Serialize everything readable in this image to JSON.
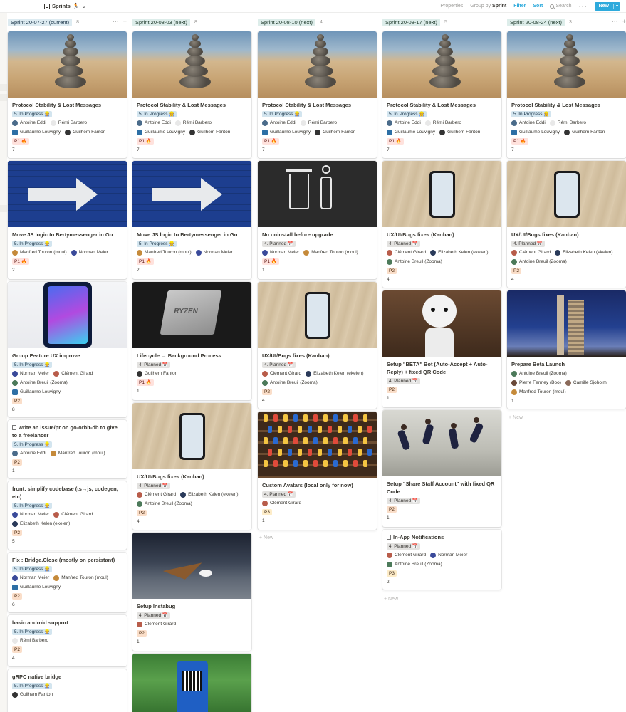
{
  "topbar": {
    "title": "Sprints",
    "properties": "Properties",
    "group_by": "Group by",
    "group_by_value": "Sprint",
    "filter": "Filter",
    "sort": "Sort",
    "search": "Search",
    "more": "···",
    "new": "New"
  },
  "add_new": "+ New",
  "columns": [
    {
      "name": "Sprint 20-07-27 (current)",
      "count": "8",
      "cards": [
        {
          "title": "Protocol Stability & Lost Messages",
          "status": "5. In Progress 👷",
          "people": [
            "Antoine Eddi",
            "Rémi Barbero",
            "Guillaume Louvigny",
            "Guilhem Fanton"
          ],
          "priority": "P1 🔥",
          "points": "7"
        },
        {
          "title": "Move JS logic to Bertymessenger in Go",
          "status": "5. In Progress 👷",
          "people": [
            "Manfred Touron (moul)",
            "Norman Meier"
          ],
          "priority": "P1 🔥",
          "points": "2"
        },
        {
          "title": "Group Feature UX improve",
          "status": "5. In Progress 👷",
          "people": [
            "Norman Meier",
            "Clément Girard",
            "Antoine Breuil (Zooma)",
            "Guillaume Louvigny"
          ],
          "priority": "P2",
          "points": "8"
        },
        {
          "title": "write an issue/pr on go-orbit-db to give to a freelancer",
          "status": "5. In Progress 👷",
          "people": [
            "Antoine Eddi",
            "Manfred Touron (moul)"
          ],
          "priority": "P2",
          "points": "1"
        },
        {
          "title": "front: simplify codebase (ts→js, codegen, etc)",
          "status": "5. In Progress 👷",
          "people": [
            "Norman Meier",
            "Clément Girard",
            "Elizabeth Kelen (ekelen)"
          ],
          "priority": "P2",
          "points": "5"
        },
        {
          "title": "Fix : Bridge.Close (mostly on persistant)",
          "status": "5. In Progress 👷",
          "people": [
            "Norman Meier",
            "Manfred Touron (moul)",
            "Guillaume Louvigny"
          ],
          "priority": "P2",
          "points": "6"
        },
        {
          "title": "basic android support",
          "status": "5. In Progress 👷",
          "people": [
            "Rémi Barbero"
          ],
          "priority": "P2",
          "points": "4"
        },
        {
          "title": "gRPC native bridge",
          "status": "5. In Progress 👷",
          "people": [
            "Guilhem Fanton"
          ]
        }
      ]
    },
    {
      "name": "Sprint 20-08-03 (next)",
      "count": "8",
      "cards": [
        {
          "title": "Protocol Stability & Lost Messages",
          "status": "5. In Progress 👷",
          "people": [
            "Antoine Eddi",
            "Rémi Barbero",
            "Guillaume Louvigny",
            "Guilhem Fanton"
          ],
          "priority": "P1 🔥",
          "points": "7"
        },
        {
          "title": "Move JS logic to Bertymessenger in Go",
          "status": "5. In Progress 👷",
          "people": [
            "Manfred Touron (moul)",
            "Norman Meier"
          ],
          "priority": "P1 🔥",
          "points": "2"
        },
        {
          "title": "Lifecycle → Background Process",
          "status": "4. Planned 📅",
          "people": [
            "Guilhem Fanton"
          ],
          "priority": "P1 🔥",
          "points": "1"
        },
        {
          "title": "UX/UI/Bugs fixes (Kanban)",
          "status": "4. Planned 📅",
          "people": [
            "Clément Girard",
            "Elizabeth Kelen (ekelen)",
            "Antoine Breuil (Zooma)"
          ],
          "priority": "P2",
          "points": "4"
        },
        {
          "title": "Setup Instabug",
          "status": "4. Planned 📅",
          "people": [
            "Clément Girard"
          ],
          "priority": "P2",
          "points": "1"
        }
      ]
    },
    {
      "name": "Sprint 20-08-10 (next)",
      "count": "4",
      "cards": [
        {
          "title": "Protocol Stability & Lost Messages",
          "status": "5. In Progress 👷",
          "people": [
            "Antoine Eddi",
            "Rémi Barbero",
            "Guillaume Louvigny",
            "Guilhem Fanton"
          ],
          "priority": "P1 🔥",
          "points": "7"
        },
        {
          "title": "No uninstall before upgrade",
          "status": "4. Planned 📅",
          "people": [
            "Norman Meier",
            "Manfred Touron (moul)"
          ],
          "priority": "P1 🔥",
          "points": "1"
        },
        {
          "title": "UX/UI/Bugs fixes (Kanban)",
          "status": "4. Planned 📅",
          "people": [
            "Clément Girard",
            "Elizabeth Kelen (ekelen)",
            "Antoine Breuil (Zooma)"
          ],
          "priority": "P2",
          "points": "4"
        },
        {
          "title": "Custom Avatars (local only for now)",
          "status": "4. Planned 📅",
          "people": [
            "Clément Girard"
          ],
          "priority": "P3",
          "points": "1"
        }
      ]
    },
    {
      "name": "Sprint 20-08-17 (next)",
      "count": "5",
      "cards": [
        {
          "title": "Protocol Stability & Lost Messages",
          "status": "5. In Progress 👷",
          "people": [
            "Antoine Eddi",
            "Rémi Barbero",
            "Guillaume Louvigny",
            "Guilhem Fanton"
          ],
          "priority": "P1 🔥",
          "points": "7"
        },
        {
          "title": "UX/UI/Bugs fixes (Kanban)",
          "status": "4. Planned 📅",
          "people": [
            "Clément Girard",
            "Elizabeth Kelen (ekelen)",
            "Antoine Breuil (Zooma)"
          ],
          "priority": "P2",
          "points": "4"
        },
        {
          "title": "Setup \"BETA\" Bot (Auto-Accept + Auto-Reply) + fixed QR Code",
          "status": "4. Planned 📅",
          "priority": "P2",
          "points": "1"
        },
        {
          "title": "Setup \"Share Staff Account\" with fixed QR Code",
          "status": "4. Planned 📅",
          "priority": "P2",
          "points": "1"
        },
        {
          "title": "In-App Notifications",
          "status": "4. Planned 📅",
          "people": [
            "Clément Girard",
            "Norman Meier",
            "Antoine Breuil (Zooma)"
          ],
          "priority": "P3",
          "points": "2"
        }
      ]
    },
    {
      "name": "Sprint 20-08-24 (next)",
      "count": "3",
      "cards": [
        {
          "title": "Protocol Stability & Lost Messages",
          "status": "5. In Progress 👷",
          "people": [
            "Antoine Eddi",
            "Rémi Barbero",
            "Guillaume Louvigny",
            "Guilhem Fanton"
          ],
          "priority": "P1 🔥",
          "points": "7"
        },
        {
          "title": "UX/UI/Bugs fixes (Kanban)",
          "status": "4. Planned 📅",
          "people": [
            "Clément Girard",
            "Elizabeth Kelen (ekelen)",
            "Antoine Breuil (Zooma)"
          ],
          "priority": "P2",
          "points": "4"
        },
        {
          "title": "Prepare Beta Launch",
          "people": [
            "Antoine Breuil (Zooma)",
            "Pierre Fermey (Boo)",
            "Camille Sjoholm",
            "Manfred Touron (moul)"
          ],
          "points": "1"
        }
      ]
    }
  ],
  "colors": {
    "accent": "#2eaadc",
    "current_header": "#ddebf1",
    "next_header": "#ddedea",
    "in_progress": "#d3e5ef",
    "planned": "#e3e2e0",
    "p1": "#ffe2dd",
    "p2": "#fadec9",
    "p3": "#fdecc8"
  }
}
